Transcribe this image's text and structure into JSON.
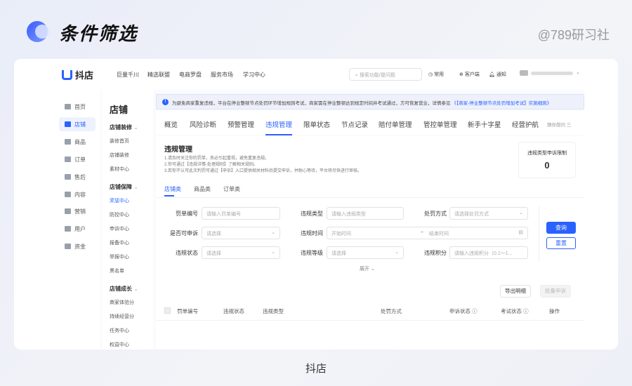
{
  "page": {
    "title": "条件筛选",
    "watermark": "@789研习社",
    "caption": "抖店"
  },
  "topnav": {
    "brand": "抖店",
    "links": [
      "巨量千川",
      "精选联盟",
      "电商罗盘",
      "服务市场",
      "学习中心"
    ],
    "search_placeholder": "搜索功能/提问题",
    "common": "常用",
    "client": "客户端",
    "notify": "通知"
  },
  "leftnav": [
    {
      "label": "首页"
    },
    {
      "label": "店铺",
      "active": true
    },
    {
      "label": "商品"
    },
    {
      "label": "订单"
    },
    {
      "label": "售后"
    },
    {
      "label": "内容"
    },
    {
      "label": "营销"
    },
    {
      "label": "用户"
    },
    {
      "label": "资金"
    }
  ],
  "subnav": {
    "title": "店铺",
    "groups": [
      {
        "label": "店铺装修",
        "items": [
          "装修首页",
          "店铺装修",
          "素材中心"
        ]
      },
      {
        "label": "店铺保障",
        "items": [
          "奖惩中心",
          "防控中心",
          "申诉中心",
          "报备中心",
          "举报中心",
          "黑名单"
        ]
      },
      {
        "label": "店铺成长",
        "items": [
          "商家体验分",
          "持续经营分",
          "任务中心",
          "权益中心"
        ]
      }
    ]
  },
  "notice": {
    "text": "为避免商家重复违规，平台在停业整顿节点处罚环节增加规则考试，商家需在停业整顿达到规定时间并考试通过，方可恢复营业，详情参见",
    "link": "《【商家-停业整顿节点处罚增加考试】实施细则》"
  },
  "tabs": [
    "概览",
    "风险诊断",
    "预警管理",
    "违规管理",
    "限单状态",
    "节点记录",
    "赔付单管理",
    "管控单管理",
    "新手十字星",
    "经营护航"
  ],
  "tabs_more": "猜你想问 三",
  "panel": {
    "title": "违规管理",
    "lines": [
      "1.请及时关注你的罚单，务必引起重视，避免重复违规。",
      "2.你可通过【违规详情-处理规则】了解相关规则。",
      "3.若你不认可此次判罚可通过【申诉】入口提供相关材料后提交申诉，并耐心等待，平台将尽快进行审核。"
    ],
    "stat_label": "违规类型申诉限制",
    "stat_value": "0",
    "cat_tabs": [
      "店铺类",
      "商品类",
      "订单类"
    ]
  },
  "filters": {
    "f1_label": "罚单编号",
    "f1_ph": "请输入罚单编号",
    "f2_label": "违规类型",
    "f2_ph": "请输入违规类型",
    "f3_label": "处罚方式",
    "f3_ph": "请选择处罚方式",
    "f4_label": "是否可申诉",
    "f4_ph": "请选择",
    "f5_label": "违规时间",
    "f5_start": "开始时间",
    "f5_sep": "~",
    "f5_end": "结束时间",
    "f6_label": "违规状态",
    "f6_ph": "请选择",
    "f7_label": "违规等级",
    "f7_ph": "请选择",
    "f8_label": "违规积分",
    "f8_ph": "请输入违规积分（0.1～1...",
    "expand": "展开 ⌄",
    "query": "查询",
    "reset": "重置"
  },
  "actions": {
    "export": "导出明细",
    "batch": "批量申诉"
  },
  "table_headers": [
    "罚单编号",
    "违规状态",
    "违规类型",
    "处罚方式",
    "申诉状态 ⓘ",
    "考试状态 ⓘ",
    "操作"
  ]
}
